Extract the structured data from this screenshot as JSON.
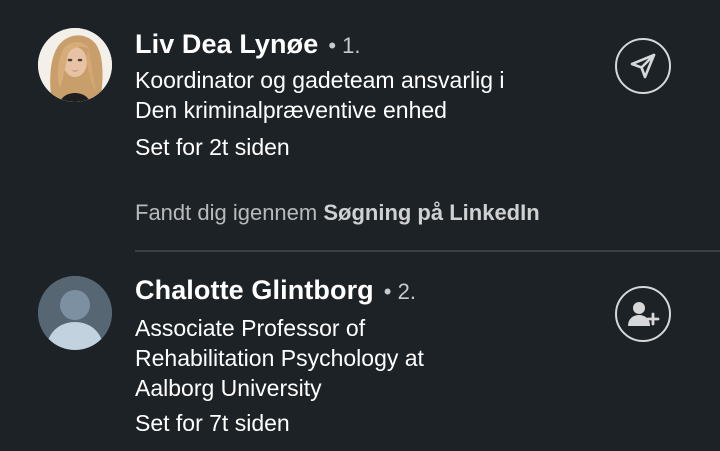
{
  "viewers": [
    {
      "name": "Liv Dea Lynøe",
      "degree": "• 1.",
      "headline_lines": [
        "Koordinator og gadeteam ansvarlig i",
        "Den kriminalpræventive enhed"
      ],
      "viewed": "Set for 2t siden",
      "found_prefix": "Fandt dig igennem ",
      "found_source": "Søgning på LinkedIn",
      "action_icon": "send-message-icon",
      "avatar": "profile-photo"
    },
    {
      "name": "Chalotte Glintborg",
      "degree": "• 2.",
      "headline_lines": [
        "Associate Professor of",
        "Rehabilitation Psychology at",
        "Aalborg University"
      ],
      "viewed": "Set for 7t siden",
      "action_icon": "add-connection-icon",
      "avatar": "default-avatar-placeholder"
    }
  ],
  "colors": {
    "background": "#1d2226",
    "text": "#ffffff",
    "muted_text": "#b9babb",
    "divider": "#3a3f43",
    "icon_stroke": "#d7d8d9",
    "placeholder_avatar": "#566673"
  }
}
